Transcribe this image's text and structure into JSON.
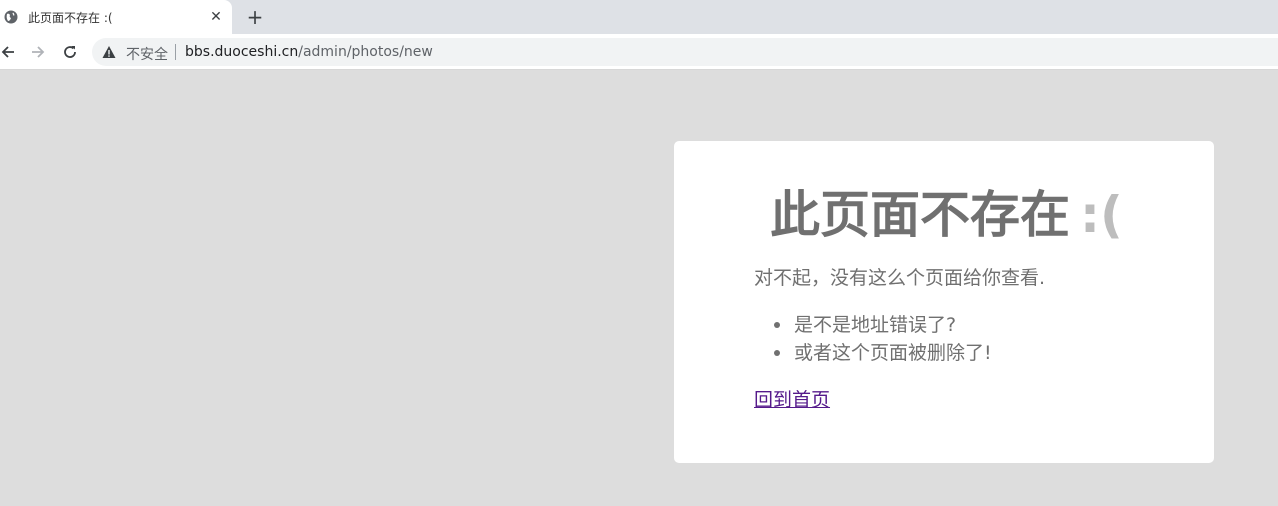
{
  "browser": {
    "tab": {
      "title": "此页面不存在 :(",
      "close_glyph": "✕",
      "favicon": "globe-icon"
    },
    "new_tab_glyph": "+",
    "nav": {
      "back": "arrow-left-icon",
      "forward": "arrow-right-icon",
      "reload": "reload-icon"
    },
    "omnibox": {
      "security_label": "不安全",
      "security_icon": "warning-triangle-icon",
      "url_host": "bbs.duoceshi.cn",
      "url_path": "/admin/photos/new"
    }
  },
  "page": {
    "heading": "此页面不存在",
    "heading_face": ":(",
    "apology": "对不起，没有这么个页面给你查看.",
    "reasons": [
      "是不是地址错误了?",
      "或者这个页面被删除了!"
    ],
    "home_link": "回到首页"
  },
  "colors": {
    "background": "#dddddd",
    "card": "#ffffff",
    "text": "#707070",
    "face": "#bdbdbd",
    "link_visited": "#551a8b"
  }
}
